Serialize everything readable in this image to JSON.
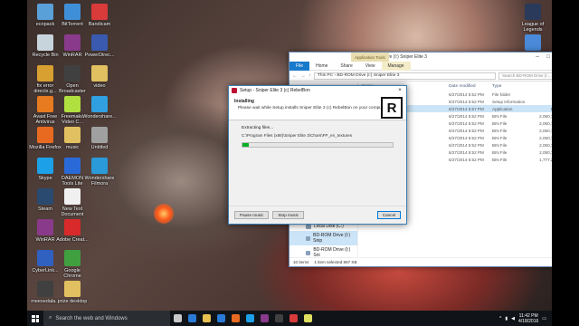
{
  "desktop": {
    "icons": [
      {
        "label": "ecopack",
        "color": "#5aa0d8",
        "col": 0,
        "row": 0
      },
      {
        "label": "BitTorrent",
        "color": "#3f8fd8",
        "col": 1,
        "row": 0
      },
      {
        "label": "Bandicam",
        "color": "#d93a3a",
        "col": 2,
        "row": 0
      },
      {
        "label": "Recycle Bin",
        "color": "#c8d4dc",
        "col": 0,
        "row": 1
      },
      {
        "label": "WinRAR",
        "color": "#8a3a8a",
        "col": 1,
        "row": 1
      },
      {
        "label": "PowerDirec...",
        "color": "#3a5ab0",
        "col": 2,
        "row": 1
      },
      {
        "label": "fix error directx.g...",
        "color": "#d8a030",
        "col": 0,
        "row": 2
      },
      {
        "label": "Open Broadcaster",
        "color": "#404040",
        "col": 1,
        "row": 2
      },
      {
        "label": "video",
        "color": "#e0c060",
        "col": 2,
        "row": 2
      },
      {
        "label": "Avast Free Antivirus",
        "color": "#e87a20",
        "col": 0,
        "row": 3
      },
      {
        "label": "Freemake Video C...",
        "color": "#b0e040",
        "col": 1,
        "row": 3
      },
      {
        "label": "Wondershare...",
        "color": "#30a0e0",
        "col": 2,
        "row": 3
      },
      {
        "label": "Mozilla Firefox",
        "color": "#e86a20",
        "col": 0,
        "row": 4
      },
      {
        "label": "music",
        "color": "#e0c060",
        "col": 1,
        "row": 4
      },
      {
        "label": "Untitled",
        "color": "#a0a0a0",
        "col": 2,
        "row": 4
      },
      {
        "label": "Skype",
        "color": "#1ca0e8",
        "col": 0,
        "row": 5
      },
      {
        "label": "DAEMON Tools Lite",
        "color": "#2a6ad8",
        "col": 1,
        "row": 5
      },
      {
        "label": "Wondershare Filmora",
        "color": "#2a9ad8",
        "col": 2,
        "row": 5
      },
      {
        "label": "Steam",
        "color": "#2a4a70",
        "col": 0,
        "row": 6
      },
      {
        "label": "New Text Document",
        "color": "#f0f0f0",
        "col": 1,
        "row": 6
      },
      {
        "label": "WinRAR",
        "color": "#8a3a8a",
        "col": 0,
        "row": 7
      },
      {
        "label": "Adobe Creat...",
        "color": "#d82a2a",
        "col": 1,
        "row": 7
      },
      {
        "label": "CyberLink...",
        "color": "#3060c0",
        "col": 0,
        "row": 8
      },
      {
        "label": "Google Chrome",
        "color": "#40a040",
        "col": 1,
        "row": 8
      },
      {
        "label": "meesedala...",
        "color": "#404040",
        "col": 0,
        "row": 9
      },
      {
        "label": "prize desktop",
        "color": "#e0c060",
        "col": 1,
        "row": 9
      }
    ],
    "right_icons": [
      {
        "label": "League of Legends",
        "color": "#2a3a5a"
      },
      {
        "label": "",
        "color": "#4a8ad8"
      }
    ]
  },
  "taskbar": {
    "search_placeholder": "Search the web and Windows",
    "time": "11:42 PM",
    "date": "4/18/2016",
    "pinned": [
      {
        "icon": "task-view-icon",
        "color": "#c8c8c8"
      },
      {
        "icon": "edge-icon",
        "color": "#2a7ad8"
      },
      {
        "icon": "file-explorer-icon",
        "color": "#e8c050"
      },
      {
        "icon": "store-icon",
        "color": "#2a7ad8"
      },
      {
        "icon": "firefox-icon",
        "color": "#e86a20"
      },
      {
        "icon": "skype-icon",
        "color": "#1ca0e8"
      },
      {
        "icon": "winrar-icon",
        "color": "#8a3a8a"
      },
      {
        "icon": "video-icon",
        "color": "#404040"
      },
      {
        "icon": "bandicam-icon",
        "color": "#d93a3a"
      },
      {
        "icon": "setup-icon",
        "color": "#e0e060"
      }
    ]
  },
  "explorer": {
    "title": "BD-ROM Drive (I:) Sniper Elite 3",
    "app_tools": "Application Tools",
    "ribbon_tabs": [
      "File",
      "Home",
      "Share",
      "View",
      "Manage"
    ],
    "address": "This PC  ›  BD-ROM Drive (I:) Sniper Elite 3",
    "search_placeholder": "Search BD-ROM Drive (I:...",
    "columns": [
      "Name",
      "Date modified",
      "Type",
      "Size"
    ],
    "files": [
      {
        "name": "",
        "date": "6/27/2014 5:52 PM",
        "type": "File folder",
        "size": ""
      },
      {
        "name": "",
        "date": "6/27/2014 5:52 PM",
        "type": "Setup Information",
        "size": "1 KB"
      },
      {
        "name": "",
        "date": "6/27/2014 5:57 PM",
        "type": "Application",
        "size": "868 KB"
      },
      {
        "name": "",
        "date": "6/27/2014 5:52 PM",
        "type": "BIN File",
        "size": "2,050,712 KB"
      },
      {
        "name": "",
        "date": "6/27/2014 5:52 PM",
        "type": "BIN File",
        "size": "2,050,743 KB"
      },
      {
        "name": "",
        "date": "6/27/2014 5:52 PM",
        "type": "BIN File",
        "size": "2,050,743 KB"
      },
      {
        "name": "",
        "date": "6/27/2014 5:52 PM",
        "type": "BIN File",
        "size": "2,050,743 KB"
      },
      {
        "name": "",
        "date": "6/27/2014 5:52 PM",
        "type": "BIN File",
        "size": "2,050,743 KB"
      },
      {
        "name": "",
        "date": "6/27/2014 5:52 PM",
        "type": "BIN File",
        "size": "2,050,743 KB"
      },
      {
        "name": "",
        "date": "6/27/2014 5:52 PM",
        "type": "BIN File",
        "size": "1,777,230 KB"
      }
    ],
    "selected_index": 2,
    "nav_items": [
      "Videos",
      "Local Disk (C:)",
      "BD-ROM Drive (I:) Snip",
      "BD-ROM Drive (I:) Sni"
    ],
    "nav_selected": 2,
    "status_items": "10 items",
    "status_selected": "1 item selected  867 KB"
  },
  "setup": {
    "title": "Setup - Sniper Elite 3 (c) RebelBon",
    "heading": "Installing",
    "subheading": "Please wait while Setup installs Sniper Elite 3 (c) RebelBon on your computer.",
    "logo_letter": "R",
    "status": "Extracting files...",
    "path": "C:\\Program Files (x86)\\Sniper Elite 3\\Chars\\FP_en_textures",
    "progress": 0.04,
    "buttons": {
      "pause": "Pause music",
      "stop": "Stop music",
      "cancel": "Cancel"
    },
    "progress_color": "#06b025"
  }
}
